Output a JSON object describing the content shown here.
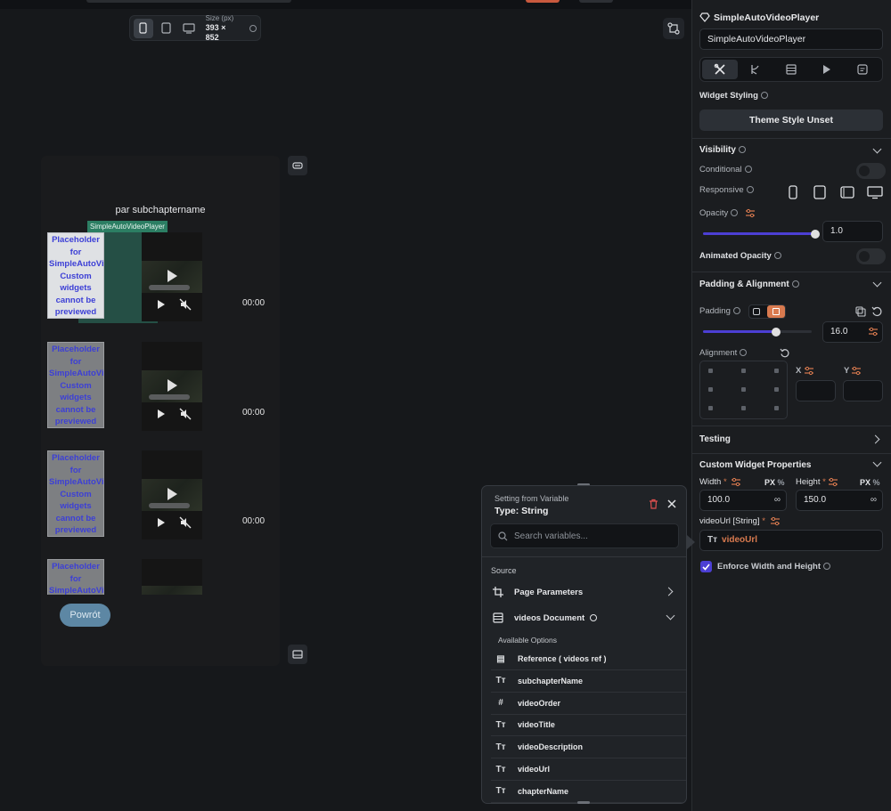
{
  "toolbar": {
    "size_label": "Size (px)",
    "size_value": "393 × 852"
  },
  "phone": {
    "title": "par subchaptername",
    "selected_tag": "SimpleAutoVideoPlayer",
    "placeholder_text": "Placeholder for SimpleAutoVideoPlayer. Custom widgets cannot be previewed on",
    "time": "00:00",
    "back_button": "Powrót"
  },
  "panel": {
    "component_name": "SimpleAutoVideoPlayer",
    "name_field": "SimpleAutoVideoPlayer",
    "widget_styling": "Widget Styling",
    "theme_button": "Theme Style Unset",
    "visibility": "Visibility",
    "conditional": "Conditional",
    "responsive": "Responsive",
    "opacity": "Opacity",
    "opacity_value": "1.0",
    "animated_opacity": "Animated Opacity",
    "padding_alignment": "Padding & Alignment",
    "padding": "Padding",
    "padding_value": "16.0",
    "alignment": "Alignment",
    "x_label": "X",
    "y_label": "Y",
    "testing": "Testing",
    "custom_props": "Custom Widget Properties",
    "width_label": "Width",
    "height_label": "Height",
    "px": "PX",
    "pct": "%",
    "width_value": "100.0",
    "height_value": "150.0",
    "infinity": "∞",
    "video_url_label": "videoUrl",
    "video_url_type": "[String]",
    "video_url_value": "videoUrl",
    "enforce": "Enforce Width and Height",
    "required": "*",
    "opacity_level": 1.0,
    "padding_level": 0.67
  },
  "popup": {
    "subtitle": "Setting from Variable",
    "type": "Type: String",
    "search_placeholder": "Search variables...",
    "source": "Source",
    "page_params": "Page Parameters",
    "videos_doc": "videos Document",
    "available": "Available Options",
    "options": [
      {
        "icon": "table-icon",
        "label": "Reference  ( videos ref )"
      },
      {
        "icon": "text-type-icon",
        "label": "subchapterName"
      },
      {
        "icon": "hash-icon",
        "label": "videoOrder"
      },
      {
        "icon": "text-type-icon",
        "label": "videoTitle"
      },
      {
        "icon": "text-type-icon",
        "label": "videoDescription"
      },
      {
        "icon": "text-type-icon",
        "label": "videoUrl"
      },
      {
        "icon": "text-type-icon",
        "label": "chapterName"
      }
    ]
  },
  "colors": {
    "accent": "#4c3fd4",
    "orange": "#d97a4f",
    "teal": "#2c7e63"
  }
}
